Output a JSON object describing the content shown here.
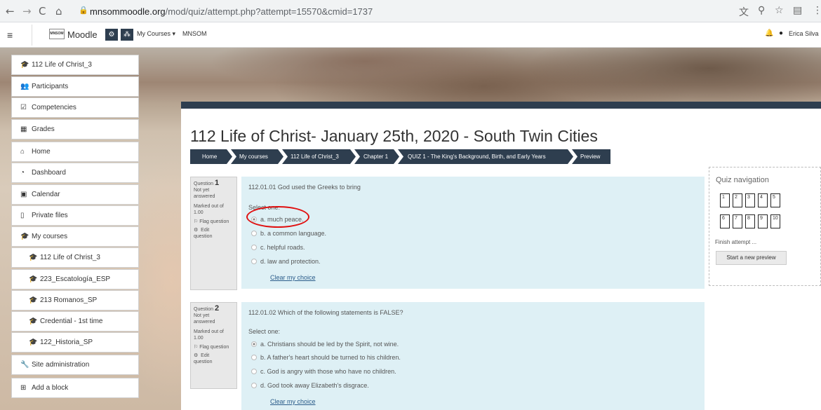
{
  "browser": {
    "url_host": "mnsommoodle.org",
    "url_path": "/mod/quiz/attempt.php?attempt=15570&cmid=1737"
  },
  "navbar": {
    "brand": "Moodle",
    "my_courses": "My Courses",
    "site": "MNSOM",
    "user": "Erica Silva"
  },
  "sidebar": {
    "items": [
      {
        "label": "112 Life of Christ_3"
      },
      {
        "label": "Participants"
      },
      {
        "label": "Competencies"
      },
      {
        "label": "Grades"
      },
      {
        "label": "Home"
      },
      {
        "label": "Dashboard"
      },
      {
        "label": "Calendar"
      },
      {
        "label": "Private files"
      },
      {
        "label": "My courses"
      },
      {
        "label": "112 Life of Christ_3"
      },
      {
        "label": "223_Escatología_ESP"
      },
      {
        "label": "213 Romanos_SP"
      },
      {
        "label": "Credential - 1st time"
      },
      {
        "label": "122_Historia_SP"
      },
      {
        "label": "Site administration"
      },
      {
        "label": "Add a block"
      }
    ]
  },
  "page": {
    "title": "112 Life of Christ- January 25th, 2020 - South Twin Cities"
  },
  "breadcrumb": [
    "Home",
    "My courses",
    "112 Life of Christ_3",
    "Chapter 1",
    "QUIZ 1 - The King's Background, Birth, and Early Years",
    "Preview"
  ],
  "questions": [
    {
      "label": "Question",
      "number": "1",
      "status": [
        "Not yet",
        "answered"
      ],
      "marked": [
        "Marked out of",
        "1.00"
      ],
      "flag": "Flag question",
      "edit": [
        "Edit",
        "question"
      ],
      "text": "112.01.01 God used the Greeks to bring",
      "select": "Select one:",
      "options": [
        "a. much peace.",
        "b. a common language.",
        "c. helpful roads.",
        "d. law and protection."
      ],
      "selected": 0,
      "clear": "Clear my choice"
    },
    {
      "label": "Question",
      "number": "2",
      "status": [
        "Not yet",
        "answered"
      ],
      "marked": [
        "Marked out of",
        "1.00"
      ],
      "flag": "Flag question",
      "edit": [
        "Edit",
        "question"
      ],
      "text": "112.01.02 Which of the following statements is FALSE?",
      "select": "Select one:",
      "options": [
        "a. Christians should be led by the Spirit, not wine.",
        "b. A father's heart should be turned to his children.",
        "c. God is angry with those who have no children.",
        "d. God took away Elizabeth's disgrace."
      ],
      "selected": 0,
      "clear": "Clear my choice"
    }
  ],
  "quiz_nav": {
    "title": "Quiz navigation",
    "buttons": [
      "1",
      "2",
      "3",
      "4",
      "5",
      "6",
      "7",
      "8",
      "9",
      "10"
    ],
    "finish": "Finish attempt ...",
    "start_new": "Start a new preview"
  },
  "colors": {
    "accent_dark": "#2e3e4f",
    "question_bg": "#def0f5",
    "link": "#2b5c8a",
    "annotation": "#e01010"
  }
}
